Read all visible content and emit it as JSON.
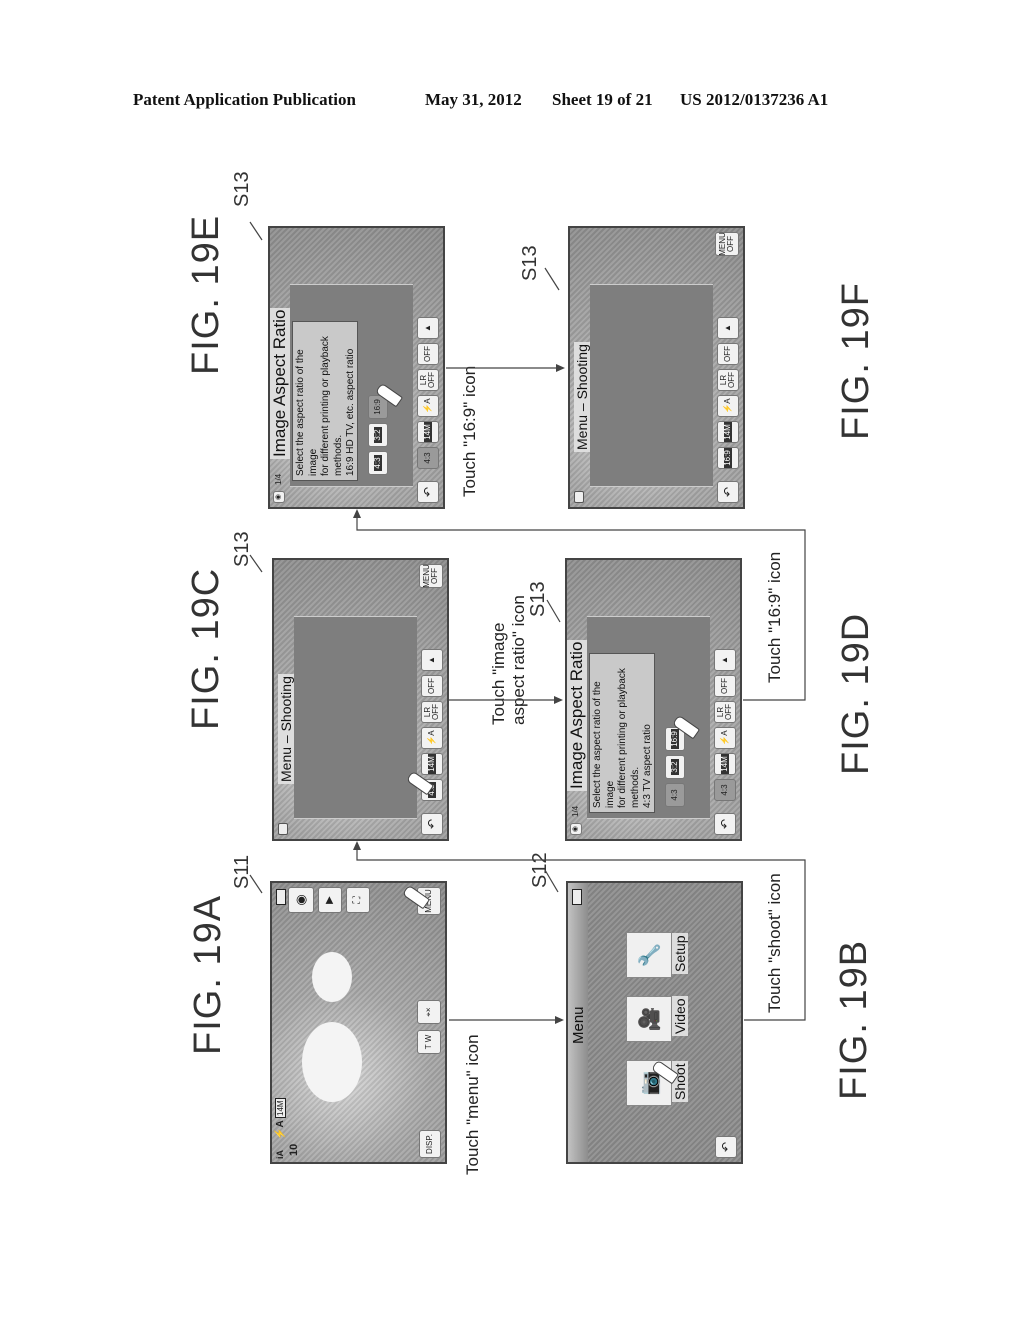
{
  "header": {
    "publication": "Patent Application Publication",
    "date": "May 31, 2012",
    "sheet": "Sheet 19 of 21",
    "number": "US 2012/0137236 A1"
  },
  "figures": {
    "fig19a": {
      "label": "FIG. 19A",
      "step": "S11",
      "caption": "Touch \"menu\" icon",
      "status": {
        "mode": "iA",
        "flash": "⚡A",
        "size": "14M",
        "shots": "10"
      },
      "buttons": {
        "disp": "DISP.",
        "menu": "MENU",
        "zoom": "T W",
        "touch": "⌖×"
      },
      "icons": [
        "battery-icon",
        "camera-mode-icon",
        "playback-icon",
        "scene-icon"
      ]
    },
    "fig19b": {
      "label": "FIG. 19B",
      "step": "S12",
      "caption": "Touch \"shoot\" icon",
      "title": "Menu",
      "items": [
        {
          "label": "Shoot",
          "icon": "camera-icon"
        },
        {
          "label": "Video",
          "icon": "video-camera-icon"
        },
        {
          "label": "Setup",
          "icon": "wrench-icon"
        }
      ]
    },
    "fig19c": {
      "label": "FIG. 19C",
      "step": "S13",
      "caption_line1": "Touch \"image",
      "caption_line2": "aspect ratio\" icon",
      "title": "Menu – Shooting",
      "toolbar": [
        "4:3",
        "14M",
        "⚡A",
        "LR OFF",
        "OFF",
        "▲"
      ],
      "menu_off": "MENU OFF"
    },
    "fig19d": {
      "label": "FIG. 19D",
      "step": "S13",
      "caption": "Touch \"16:9\" icon",
      "title": "Image Aspect Ratio",
      "page": "1/4",
      "desc_lines": [
        "Select the aspect ratio of the image",
        "for different printing or playback",
        "methods.",
        "4:3  TV aspect ratio"
      ],
      "options": [
        "4:3",
        "3:2",
        "16:9"
      ],
      "toolbar": [
        "4:3",
        "14M",
        "⚡A",
        "LR OFF",
        "OFF",
        "▲"
      ]
    },
    "fig19e": {
      "label": "FIG. 19E",
      "step": "S13",
      "caption": "Touch \"16:9\" icon",
      "title": "Image Aspect Ratio",
      "page": "1/4",
      "desc_lines": [
        "Select the aspect ratio of the image",
        "for different printing or playback",
        "methods.",
        "16:9  HD TV, etc. aspect ratio"
      ],
      "options": [
        "4:3",
        "3:2",
        "16:9"
      ],
      "toolbar": [
        "4:3",
        "14M",
        "⚡A",
        "LR OFF",
        "OFF",
        "▲"
      ]
    },
    "fig19f": {
      "label": "FIG. 19F",
      "step": "S13",
      "title": "Menu – Shooting",
      "toolbar": [
        "16:9",
        "14M",
        "⚡A",
        "LR OFF",
        "OFF",
        "▲"
      ],
      "menu_off": "MENU OFF"
    }
  }
}
